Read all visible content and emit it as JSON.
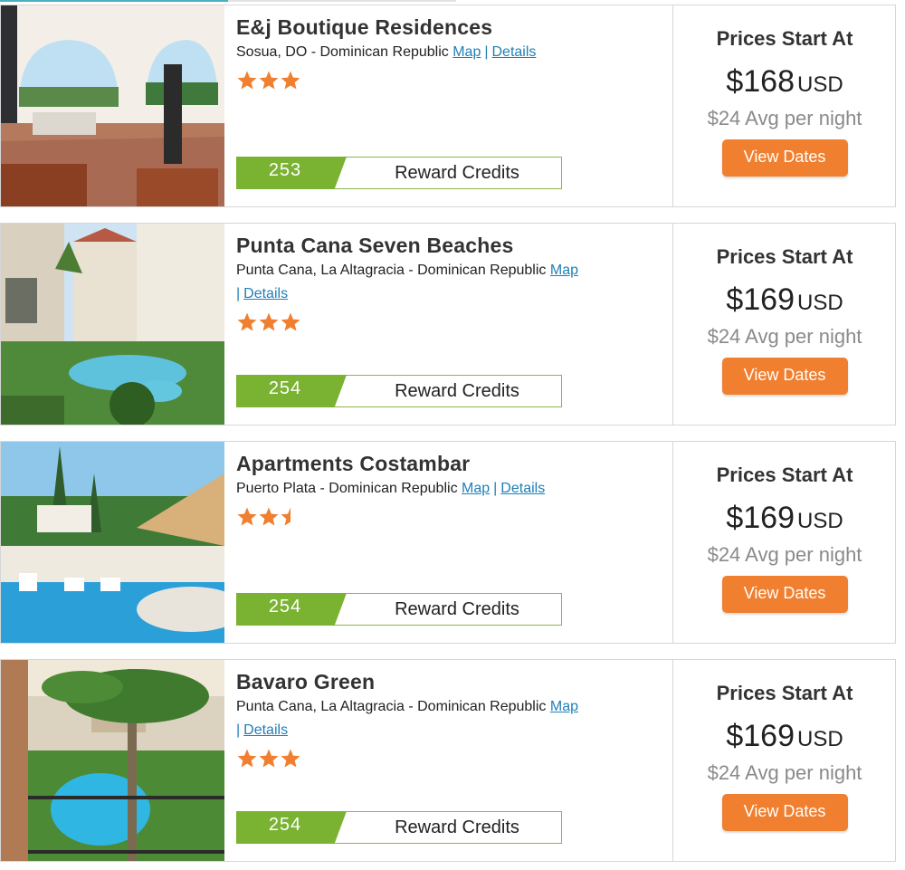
{
  "listings": [
    {
      "name": "E&j Boutique Residences",
      "location": "Sosua, DO - Dominican Republic",
      "map_label": "Map",
      "details_label": "Details",
      "rating": 3,
      "reward_points": "253",
      "reward_label": "Reward Credits",
      "price_heading": "Prices Start At",
      "price": "$168",
      "currency": "USD",
      "avg_text": "$24 Avg per night",
      "button_label": "View Dates"
    },
    {
      "name": "Punta Cana Seven Beaches",
      "location": "Punta Cana, La Altagracia - Dominican Republic",
      "map_label": "Map",
      "details_label": "Details",
      "rating": 3,
      "reward_points": "254",
      "reward_label": "Reward Credits",
      "price_heading": "Prices Start At",
      "price": "$169",
      "currency": "USD",
      "avg_text": "$24 Avg per night",
      "button_label": "View Dates"
    },
    {
      "name": "Apartments Costambar",
      "location": "Puerto Plata - Dominican Republic",
      "map_label": "Map",
      "details_label": "Details",
      "rating": 2.5,
      "reward_points": "254",
      "reward_label": "Reward Credits",
      "price_heading": "Prices Start At",
      "price": "$169",
      "currency": "USD",
      "avg_text": "$24 Avg per night",
      "button_label": "View Dates"
    },
    {
      "name": "Bavaro Green",
      "location": "Punta Cana, La Altagracia - Dominican Republic",
      "map_label": "Map",
      "details_label": "Details",
      "rating": 3,
      "reward_points": "254",
      "reward_label": "Reward Credits",
      "price_heading": "Prices Start At",
      "price": "$169",
      "currency": "USD",
      "avg_text": "$24 Avg per night",
      "button_label": "View Dates"
    }
  ],
  "colors": {
    "star": "#f07f30",
    "button": "#f07f30",
    "reward_green": "#7ab232",
    "link": "#1f7fb7"
  }
}
